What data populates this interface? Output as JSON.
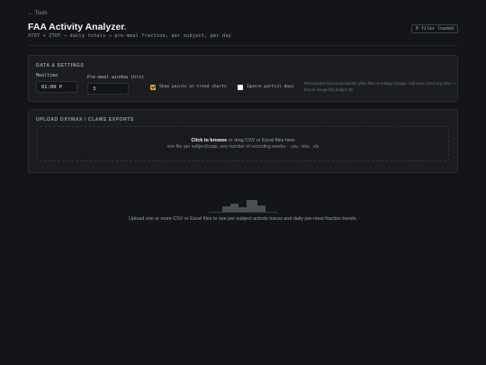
{
  "nav": {
    "back_label": "← Tools"
  },
  "header": {
    "title": "FAA Activity Analyzer",
    "title_dot": ".",
    "subtitle": "XTOT + ZTOT → daily totals → pre-meal fraction, per subject, per day",
    "files_badge": "0 files loaded"
  },
  "settings": {
    "section_title": "DATA & SETTINGS",
    "mealtime_label": "Mealtime",
    "mealtime_value": "01:00 P",
    "premeal_label": "Pre-meal window (hrs)",
    "premeal_value": "3",
    "show_points_label": "Show points on trend charts",
    "show_points_checked": true,
    "ignore_partial_label": "Ignore partial days",
    "ignore_partial_checked": false,
    "hint": "Recomputes runs automatically when files or settings change. Add more CSVs any time — they're merged by Subject ID."
  },
  "upload": {
    "section_title": "UPLOAD OXYMAX / CLAMS EXPORTS",
    "browse_label": "Click to browse",
    "drag_text": " or drag CSV or Excel files here",
    "help_text": "one file per subject/cage, any number of recording weeks · .csv, .xlsx, .xls"
  },
  "empty_state": {
    "message": "Upload one or more CSV or Excel files to see per-subject activity traces and daily pre-meal fraction trends.",
    "icon": "bar-chart-icon"
  },
  "colors": {
    "background": "#131518",
    "panel": "#1b1d21",
    "accent": "#e8a33a",
    "text": "#c9ccd1"
  }
}
